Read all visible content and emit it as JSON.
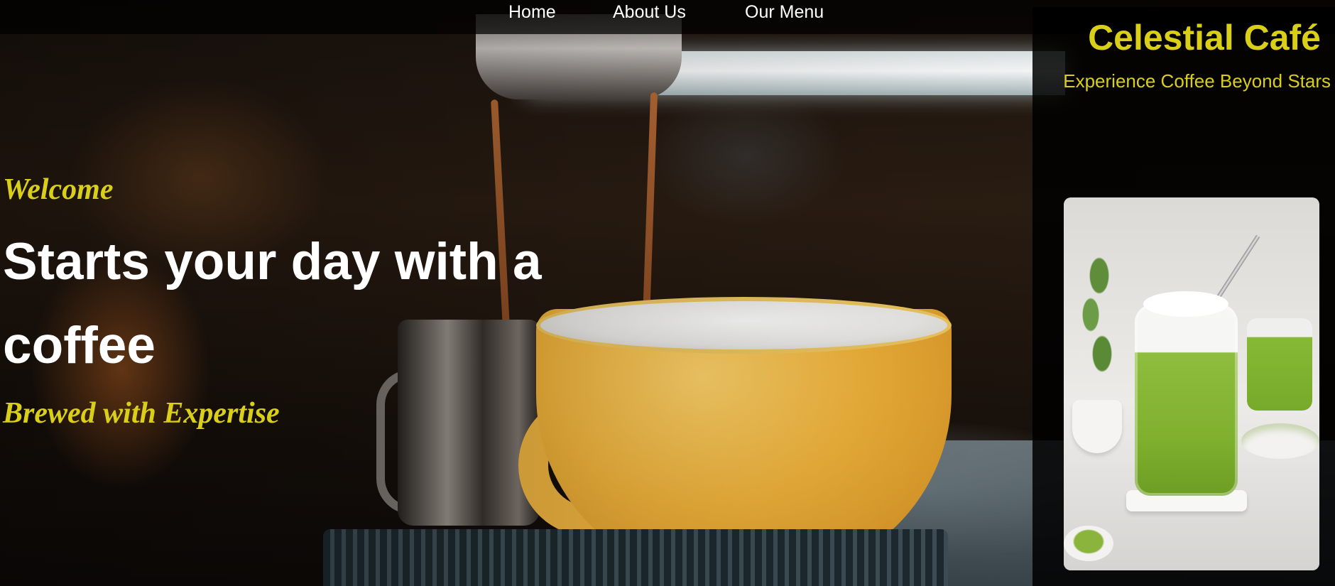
{
  "nav": {
    "items": [
      {
        "label": "Home"
      },
      {
        "label": "About Us"
      },
      {
        "label": "Our Menu"
      }
    ]
  },
  "brand": {
    "title": "Celestial Café",
    "tagline": "Experience Coffee Beyond Stars"
  },
  "hero": {
    "welcome": "Welcome",
    "headline": "Starts your day with a coffee",
    "subheading": "Brewed with Expertise"
  },
  "colors": {
    "accent": "#d9cf18",
    "text": "#ffffff",
    "nav_bg": "#000000"
  }
}
